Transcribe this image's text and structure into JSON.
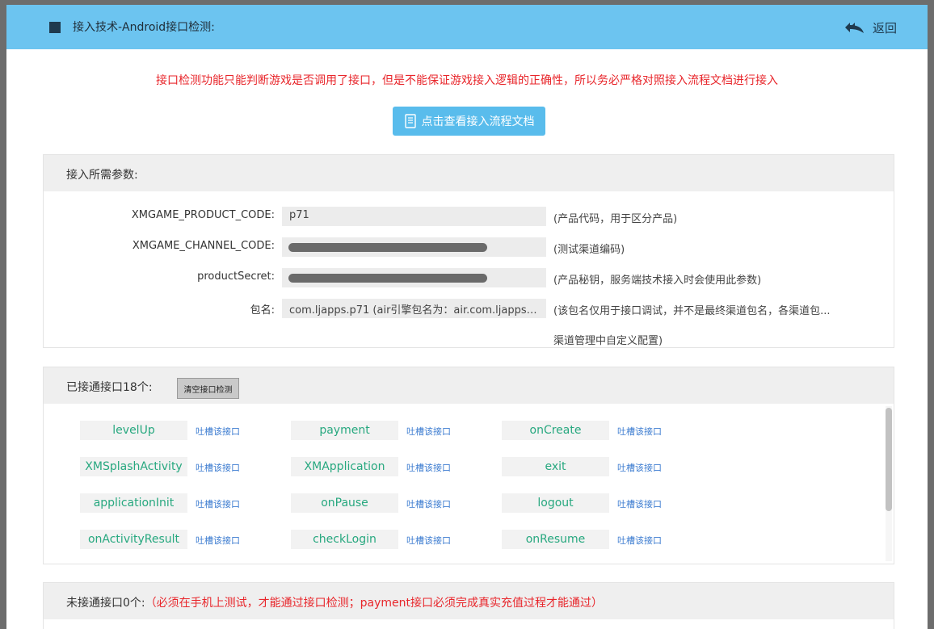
{
  "header": {
    "title": "接入技术-Android接口检测:",
    "back_label": "返回"
  },
  "warning": "接口检测功能只能判断游戏是否调用了接口，但是不能保证游戏接入逻辑的正确性，所以务必严格对照接入流程文档进行接入",
  "doc_button": "点击查看接入流程文档",
  "params_panel": {
    "title": "接入所需参数:",
    "rows": [
      {
        "label": "XMGAME_PRODUCT_CODE:",
        "value": "p71",
        "hint": "(产品代码，用于区分产品)"
      },
      {
        "label": "XMGAME_CHANNEL_CODE:",
        "value": "",
        "hint": "(测试渠道编码)"
      },
      {
        "label": "productSecret:",
        "value": "",
        "hint": "(产品秘钥，服务端技术接入时会使用此参数)"
      },
      {
        "label": "包名:",
        "value": "com.ljapps.p71 (air引擎包名为：air.com.ljapps....",
        "hint": "(该包名仅用于接口调试，并不是最终渠道包名，各渠道包..."
      }
    ],
    "hint_line2": "渠道管理中自定义配置)"
  },
  "connected_panel": {
    "title": "已接通接口18个:",
    "clear_button": "清空接口检测",
    "complain_label": "吐槽该接口",
    "apis": [
      "levelUp",
      "payment",
      "onCreate",
      "XMSplashActivity",
      "XMApplication",
      "exit",
      "applicationInit",
      "onPause",
      "logout",
      "onActivityResult",
      "checkLogin",
      "onResume"
    ]
  },
  "unconnected_panel": {
    "title": "未接通接口0个:",
    "note": "（必须在手机上测试，才能通过接口检测；payment接口必须完成真实充值过程才能通过）"
  },
  "colors": {
    "header_bg": "#6cc4f0",
    "warning": "#e8262b",
    "button": "#59bcec",
    "api_name": "#27a87f",
    "link": "#3b7bd0"
  }
}
